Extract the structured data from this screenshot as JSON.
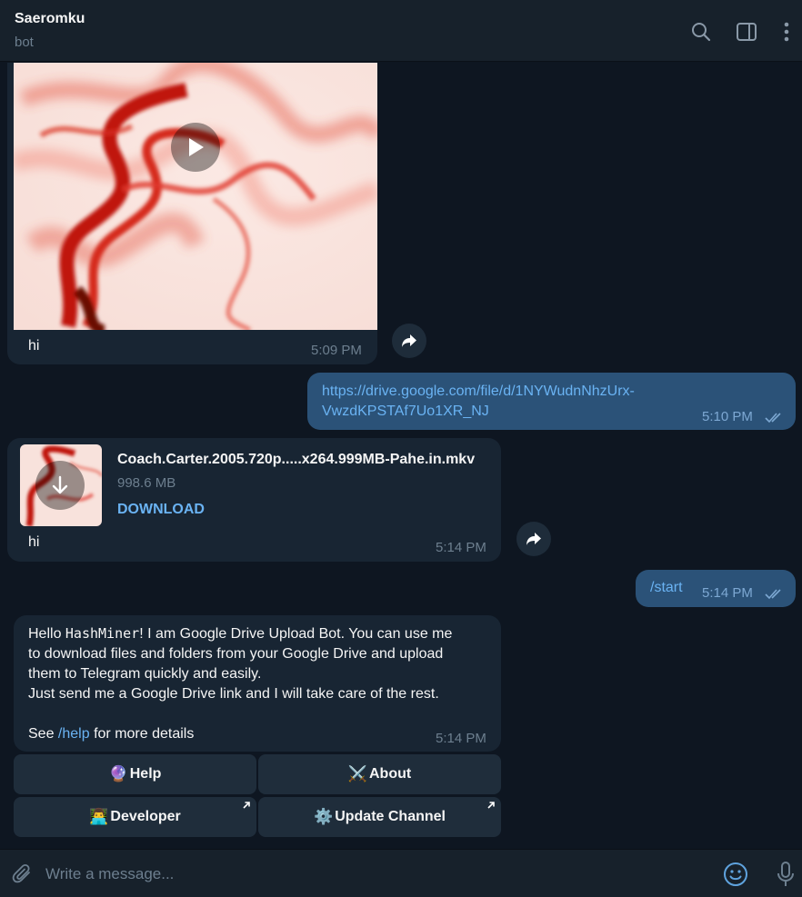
{
  "header": {
    "title": "Saeromku",
    "subtitle": "bot",
    "icons": [
      "search-icon",
      "sidebar-toggle-icon",
      "more-vertical-icon"
    ]
  },
  "messages": {
    "video": {
      "caption": "hi",
      "time": "5:09 PM"
    },
    "link": {
      "line1": "https://drive.google.com/file/d/1NYWudnNhzUrx-",
      "line2": "VwzdKPSTAf7Uo1XR_NJ",
      "time": "5:10 PM"
    },
    "file": {
      "name": "Coach.Carter.2005.720p.....x264.999MB-Pahe.in.mkv",
      "size": "998.6 MB",
      "action": "DOWNLOAD",
      "caption": "hi",
      "time": "5:14 PM"
    },
    "start": {
      "text": "/start",
      "time": "5:14 PM"
    },
    "welcome": {
      "hello": "Hello ",
      "user": "HashMiner",
      "line1_rest": "! I am Google Drive Upload Bot. You can use me",
      "line2": "to download files and folders from your Google Drive and upload",
      "line3": "them to Telegram quickly and easily.",
      "line4": "Just send me a Google Drive link and I will take care of the rest.",
      "see": "See ",
      "help_cmd": "/help",
      "see_rest": " for more details",
      "time": "5:14 PM"
    }
  },
  "keyboard": {
    "help": {
      "emoji": "🔮",
      "label": "Help"
    },
    "about": {
      "emoji": "⚔️",
      "label": "About"
    },
    "developer": {
      "emoji": "👨‍💻",
      "label": "Developer"
    },
    "update": {
      "emoji": "⚙️",
      "label": "Update Channel"
    }
  },
  "composer": {
    "placeholder": "Write a message..."
  },
  "colors": {
    "background": "#0e1621",
    "header": "#17212b",
    "incoming": "#182533",
    "outgoing": "#2b5278",
    "link": "#6ab3f3",
    "muted": "#6d7f8f"
  }
}
